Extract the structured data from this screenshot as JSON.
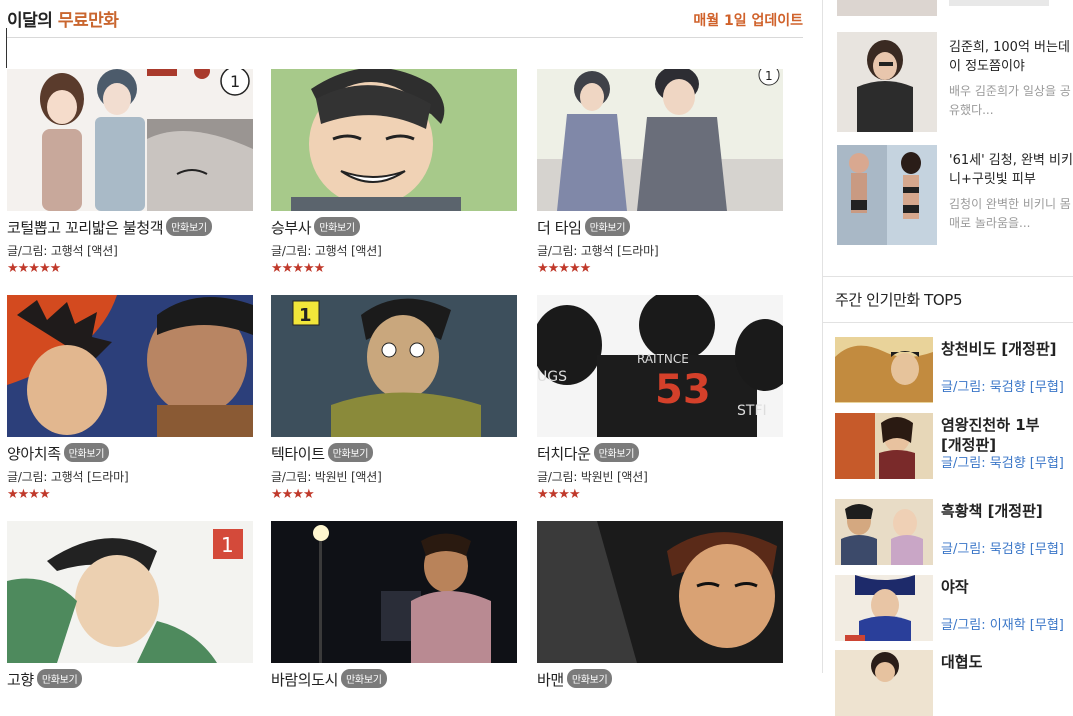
{
  "section": {
    "title_prefix": "이달의",
    "title_accent": "무료만화",
    "update_note": "매월 1일 업데이트"
  },
  "comics": [
    {
      "title": "코털뽑고 꼬리밟은 불청객",
      "badge": "만화보기",
      "meta": "글/그림: 고행석 [액션]",
      "stars": "★★★★★",
      "rating": 4.5
    },
    {
      "title": "승부사",
      "badge": "만화보기",
      "meta": "글/그림: 고행석 [액션]",
      "stars": "★★★★★",
      "rating": 4.5
    },
    {
      "title": "더 타임",
      "badge": "만화보기",
      "meta": "글/그림: 고행석 [드라마]",
      "stars": "★★★★★",
      "rating": 5
    },
    {
      "title": "양아치족",
      "badge": "만화보기",
      "meta": "글/그림: 고행석 [드라마]",
      "stars": "★★★★",
      "rating": 4
    },
    {
      "title": "텍타이트",
      "badge": "만화보기",
      "meta": "글/그림: 박원빈 [액션]",
      "stars": "★★★★",
      "rating": 3.5
    },
    {
      "title": "터치다운",
      "badge": "만화보기",
      "meta": "글/그림: 박원빈 [액션]",
      "stars": "★★★★",
      "rating": 3.5
    },
    {
      "title": "고향",
      "badge": "만화보기",
      "meta": "",
      "stars": "",
      "rating": 0
    },
    {
      "title": "바람의도시",
      "badge": "만화보기",
      "meta": "",
      "stars": "",
      "rating": 0
    },
    {
      "title": "바맨",
      "badge": "만화보기",
      "meta": "",
      "stars": "",
      "rating": 0
    }
  ],
  "sidebar": {
    "news": [
      {
        "title_line1": "김준희, 100억 버는데",
        "title_line2": "이 정도쯤이야",
        "desc_line1": "배우 김준희가 일상을 공",
        "desc_line2": "유했다..."
      },
      {
        "title_line1": "'61세' 김청, 완벽 비키",
        "title_line2": "니+구릿빛 피부",
        "desc_line1": "김청이 완벽한 비키니 몸",
        "desc_line2": "매로 놀라움을..."
      }
    ],
    "ranking_title": "주간 인기만화 TOP5",
    "ranking": [
      {
        "title_line1": "창천비도 [개정판]",
        "title_line2": "",
        "meta": "글/그림: 묵검향 [무협]"
      },
      {
        "title_line1": "염왕진천하 1부",
        "title_line2": "[개정판]",
        "meta": "글/그림: 묵검향 [무협]"
      },
      {
        "title_line1": "흑황책 [개정판]",
        "title_line2": "",
        "meta": "글/그림: 묵검향 [무협]"
      },
      {
        "title_line1": "야작",
        "title_line2": "",
        "meta": "글/그림: 이재학 [무협]"
      },
      {
        "title_line1": "대협도",
        "title_line2": "",
        "meta": ""
      }
    ]
  },
  "colors": {
    "accent": "#c9662f",
    "star": "#c0392b",
    "badge": "#7b7b7b",
    "link": "#3b77c8"
  }
}
